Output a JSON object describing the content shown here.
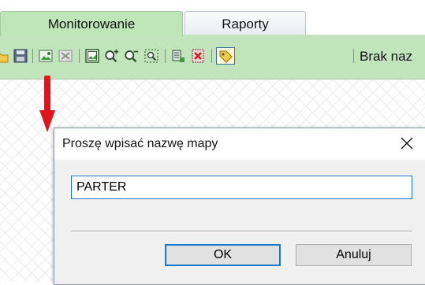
{
  "tabs": [
    {
      "label": "Monitorowanie",
      "active": true
    },
    {
      "label": "Raporty",
      "active": false
    }
  ],
  "toolbar": {
    "label": "Brak naz",
    "buttons": [
      "open-icon",
      "save-icon",
      "add-map-icon",
      "delete-map-icon",
      "image-icon",
      "zoom-in-icon",
      "zoom-out-icon",
      "zoom-fit-icon",
      "add-device-icon",
      "remove-device-icon",
      "tag-icon"
    ]
  },
  "dialog": {
    "title": "Proszę wpisać nazwę mapy",
    "close_glyph": "✕",
    "input_value": "PARTER",
    "ok_label": "OK",
    "cancel_label": "Anuluj"
  },
  "colors": {
    "active_tab": "#bfe6b7",
    "toolbar_bg": "#c2e4bd",
    "arrow": "#e0141c",
    "ok_border": "#1979ca"
  }
}
